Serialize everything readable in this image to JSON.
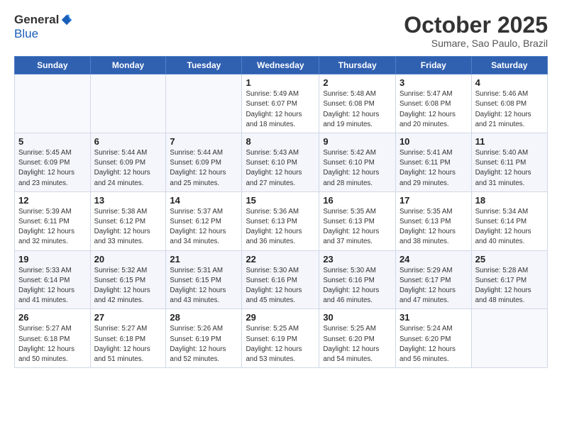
{
  "header": {
    "logo_general": "General",
    "logo_blue": "Blue",
    "month": "October 2025",
    "location": "Sumare, Sao Paulo, Brazil"
  },
  "weekdays": [
    "Sunday",
    "Monday",
    "Tuesday",
    "Wednesday",
    "Thursday",
    "Friday",
    "Saturday"
  ],
  "weeks": [
    [
      {
        "day": "",
        "info": ""
      },
      {
        "day": "",
        "info": ""
      },
      {
        "day": "",
        "info": ""
      },
      {
        "day": "1",
        "info": "Sunrise: 5:49 AM\nSunset: 6:07 PM\nDaylight: 12 hours\nand 18 minutes."
      },
      {
        "day": "2",
        "info": "Sunrise: 5:48 AM\nSunset: 6:08 PM\nDaylight: 12 hours\nand 19 minutes."
      },
      {
        "day": "3",
        "info": "Sunrise: 5:47 AM\nSunset: 6:08 PM\nDaylight: 12 hours\nand 20 minutes."
      },
      {
        "day": "4",
        "info": "Sunrise: 5:46 AM\nSunset: 6:08 PM\nDaylight: 12 hours\nand 21 minutes."
      }
    ],
    [
      {
        "day": "5",
        "info": "Sunrise: 5:45 AM\nSunset: 6:09 PM\nDaylight: 12 hours\nand 23 minutes."
      },
      {
        "day": "6",
        "info": "Sunrise: 5:44 AM\nSunset: 6:09 PM\nDaylight: 12 hours\nand 24 minutes."
      },
      {
        "day": "7",
        "info": "Sunrise: 5:44 AM\nSunset: 6:09 PM\nDaylight: 12 hours\nand 25 minutes."
      },
      {
        "day": "8",
        "info": "Sunrise: 5:43 AM\nSunset: 6:10 PM\nDaylight: 12 hours\nand 27 minutes."
      },
      {
        "day": "9",
        "info": "Sunrise: 5:42 AM\nSunset: 6:10 PM\nDaylight: 12 hours\nand 28 minutes."
      },
      {
        "day": "10",
        "info": "Sunrise: 5:41 AM\nSunset: 6:11 PM\nDaylight: 12 hours\nand 29 minutes."
      },
      {
        "day": "11",
        "info": "Sunrise: 5:40 AM\nSunset: 6:11 PM\nDaylight: 12 hours\nand 31 minutes."
      }
    ],
    [
      {
        "day": "12",
        "info": "Sunrise: 5:39 AM\nSunset: 6:11 PM\nDaylight: 12 hours\nand 32 minutes."
      },
      {
        "day": "13",
        "info": "Sunrise: 5:38 AM\nSunset: 6:12 PM\nDaylight: 12 hours\nand 33 minutes."
      },
      {
        "day": "14",
        "info": "Sunrise: 5:37 AM\nSunset: 6:12 PM\nDaylight: 12 hours\nand 34 minutes."
      },
      {
        "day": "15",
        "info": "Sunrise: 5:36 AM\nSunset: 6:13 PM\nDaylight: 12 hours\nand 36 minutes."
      },
      {
        "day": "16",
        "info": "Sunrise: 5:35 AM\nSunset: 6:13 PM\nDaylight: 12 hours\nand 37 minutes."
      },
      {
        "day": "17",
        "info": "Sunrise: 5:35 AM\nSunset: 6:13 PM\nDaylight: 12 hours\nand 38 minutes."
      },
      {
        "day": "18",
        "info": "Sunrise: 5:34 AM\nSunset: 6:14 PM\nDaylight: 12 hours\nand 40 minutes."
      }
    ],
    [
      {
        "day": "19",
        "info": "Sunrise: 5:33 AM\nSunset: 6:14 PM\nDaylight: 12 hours\nand 41 minutes."
      },
      {
        "day": "20",
        "info": "Sunrise: 5:32 AM\nSunset: 6:15 PM\nDaylight: 12 hours\nand 42 minutes."
      },
      {
        "day": "21",
        "info": "Sunrise: 5:31 AM\nSunset: 6:15 PM\nDaylight: 12 hours\nand 43 minutes."
      },
      {
        "day": "22",
        "info": "Sunrise: 5:30 AM\nSunset: 6:16 PM\nDaylight: 12 hours\nand 45 minutes."
      },
      {
        "day": "23",
        "info": "Sunrise: 5:30 AM\nSunset: 6:16 PM\nDaylight: 12 hours\nand 46 minutes."
      },
      {
        "day": "24",
        "info": "Sunrise: 5:29 AM\nSunset: 6:17 PM\nDaylight: 12 hours\nand 47 minutes."
      },
      {
        "day": "25",
        "info": "Sunrise: 5:28 AM\nSunset: 6:17 PM\nDaylight: 12 hours\nand 48 minutes."
      }
    ],
    [
      {
        "day": "26",
        "info": "Sunrise: 5:27 AM\nSunset: 6:18 PM\nDaylight: 12 hours\nand 50 minutes."
      },
      {
        "day": "27",
        "info": "Sunrise: 5:27 AM\nSunset: 6:18 PM\nDaylight: 12 hours\nand 51 minutes."
      },
      {
        "day": "28",
        "info": "Sunrise: 5:26 AM\nSunset: 6:19 PM\nDaylight: 12 hours\nand 52 minutes."
      },
      {
        "day": "29",
        "info": "Sunrise: 5:25 AM\nSunset: 6:19 PM\nDaylight: 12 hours\nand 53 minutes."
      },
      {
        "day": "30",
        "info": "Sunrise: 5:25 AM\nSunset: 6:20 PM\nDaylight: 12 hours\nand 54 minutes."
      },
      {
        "day": "31",
        "info": "Sunrise: 5:24 AM\nSunset: 6:20 PM\nDaylight: 12 hours\nand 56 minutes."
      },
      {
        "day": "",
        "info": ""
      }
    ]
  ]
}
